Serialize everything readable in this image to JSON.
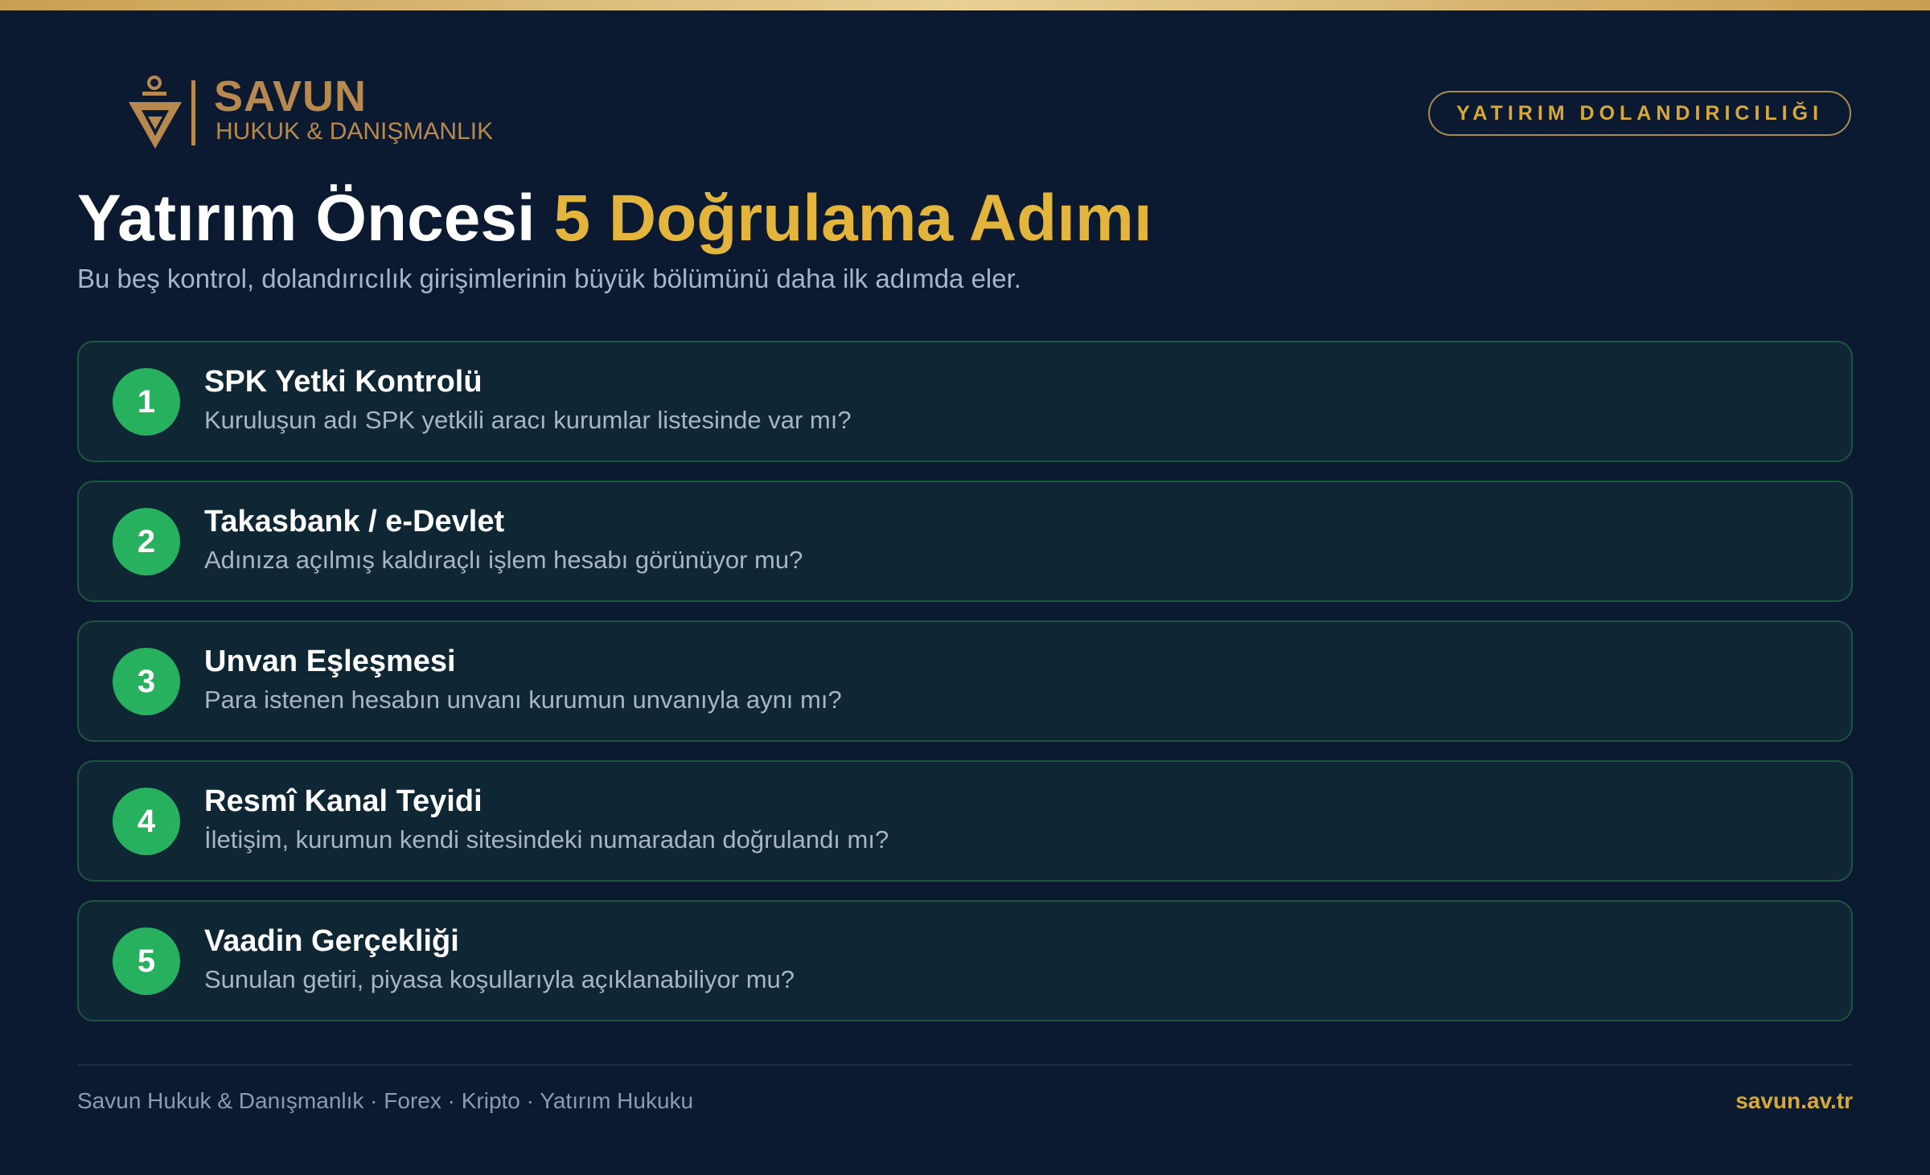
{
  "brand": {
    "name": "SAVUN",
    "subtitle": "HUKUK & DANIŞMANLIK",
    "logo_icon": "savun-logo-icon"
  },
  "badge": "YATIRIM DOLANDIRICILIĞI",
  "title": {
    "main": "Yatırım Öncesi ",
    "accent": "5 Doğrulama Adımı"
  },
  "subtitle": "Bu beş kontrol, dolandırıcılık girişimlerinin büyük bölümünü daha ilk adımda eler.",
  "steps": [
    {
      "number": "1",
      "title": "SPK Yetki Kontrolü",
      "description": "Kuruluşun adı SPK yetkili aracı kurumlar listesinde var mı?"
    },
    {
      "number": "2",
      "title": "Takasbank / e-Devlet",
      "description": "Adınıza açılmış kaldıraçlı işlem hesabı görünüyor mu?"
    },
    {
      "number": "3",
      "title": "Unvan Eşleşmesi",
      "description": "Para istenen hesabın unvanı kurumun unvanıyla aynı mı?"
    },
    {
      "number": "4",
      "title": "Resmî Kanal Teyidi",
      "description": "İletişim, kurumun kendi sitesindeki numaradan doğrulandı mı?"
    },
    {
      "number": "5",
      "title": "Vaadin Gerçekliği",
      "description": "Sunulan getiri, piyasa koşullarıyla açıklanabiliyor mu?"
    }
  ],
  "footer": {
    "left": "Savun Hukuk & Danışmanlık · Forex · Kripto · Yatırım Hukuku",
    "right": "savun.av.tr"
  },
  "colors": {
    "background": "#0b1a30",
    "gold": "#d7a93c",
    "accent_title": "#e4b53c",
    "step_circle": "#27b15e",
    "card_background": "#0f2634",
    "card_border": "#1d5540"
  }
}
